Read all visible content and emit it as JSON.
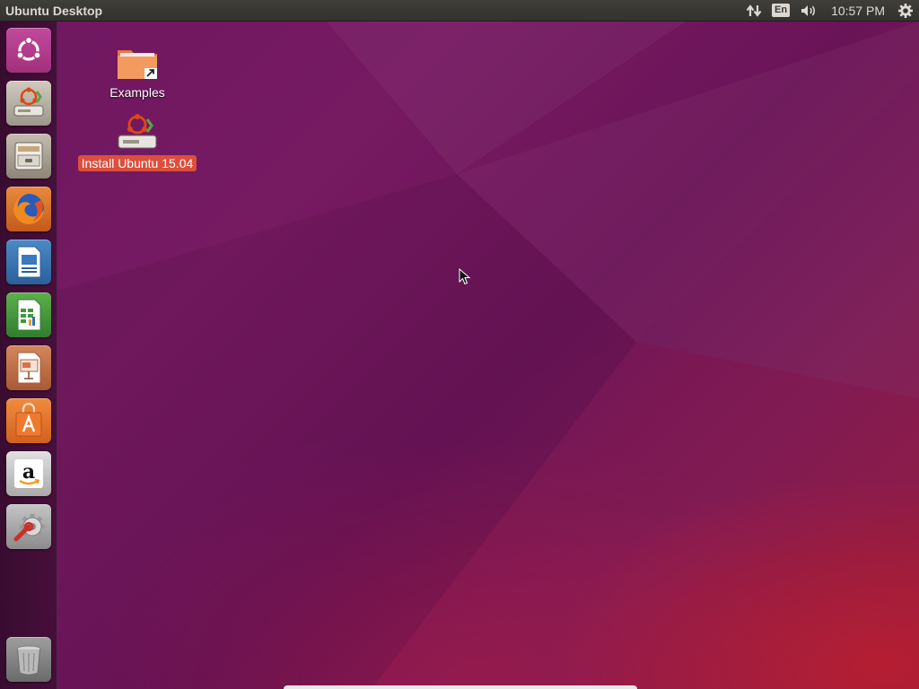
{
  "panel": {
    "title": "Ubuntu Desktop",
    "keyboard_layout": "En",
    "clock": "10:57 PM"
  },
  "indicators": {
    "network_icon": "network-updown-icon",
    "volume_icon": "speaker-icon",
    "session_icon": "gear-icon"
  },
  "launcher": {
    "items": [
      {
        "name": "dash-home",
        "icon": "ubuntu-logo-icon"
      },
      {
        "name": "install-ubuntu",
        "icon": "installer-icon"
      },
      {
        "name": "files",
        "icon": "file-cabinet-icon"
      },
      {
        "name": "firefox",
        "icon": "firefox-icon"
      },
      {
        "name": "libreoffice-writer",
        "icon": "writer-document-icon"
      },
      {
        "name": "libreoffice-calc",
        "icon": "calc-spreadsheet-icon"
      },
      {
        "name": "libreoffice-impress",
        "icon": "impress-presentation-icon"
      },
      {
        "name": "ubuntu-software-center",
        "icon": "shopping-bag-icon"
      },
      {
        "name": "amazon",
        "icon": "amazon-logo-icon"
      },
      {
        "name": "system-settings",
        "icon": "wrench-gear-icon"
      },
      {
        "name": "trash",
        "icon": "trash-icon"
      }
    ]
  },
  "desktop": {
    "icons": [
      {
        "label": "Examples",
        "icon": "folder-link-icon",
        "selected": false
      },
      {
        "label": "Install Ubuntu 15.04",
        "icon": "installer-icon",
        "selected": true
      }
    ]
  },
  "colors": {
    "accent": "#dd4f3c",
    "panel_bg": "#3a3935",
    "wallpaper_purple": "#6e1760",
    "wallpaper_red": "#8e1b3f"
  }
}
